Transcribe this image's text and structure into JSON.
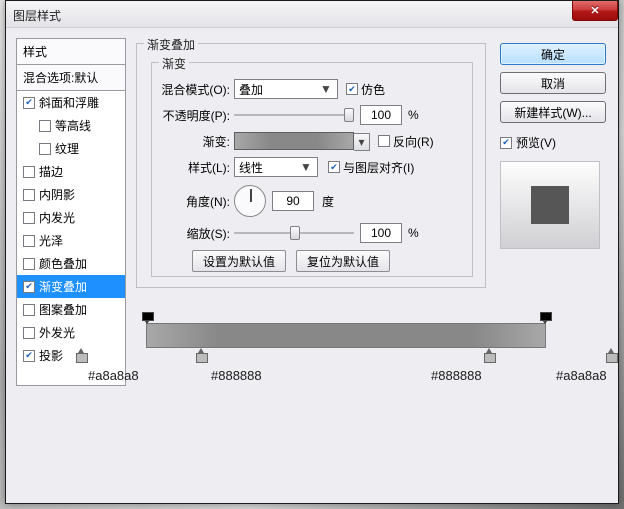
{
  "window": {
    "title": "图层样式"
  },
  "styles_panel": {
    "header": "样式",
    "blend_defaults": "混合选项:默认",
    "items": [
      {
        "label": "斜面和浮雕",
        "checked": true,
        "indent": false
      },
      {
        "label": "等高线",
        "checked": false,
        "indent": true
      },
      {
        "label": "纹理",
        "checked": false,
        "indent": true
      },
      {
        "label": "描边",
        "checked": false,
        "indent": false
      },
      {
        "label": "内阴影",
        "checked": false,
        "indent": false
      },
      {
        "label": "内发光",
        "checked": false,
        "indent": false
      },
      {
        "label": "光泽",
        "checked": false,
        "indent": false
      },
      {
        "label": "颜色叠加",
        "checked": false,
        "indent": false
      },
      {
        "label": "渐变叠加",
        "checked": true,
        "indent": false,
        "selected": true
      },
      {
        "label": "图案叠加",
        "checked": false,
        "indent": false
      },
      {
        "label": "外发光",
        "checked": false,
        "indent": false
      },
      {
        "label": "投影",
        "checked": true,
        "indent": false
      }
    ]
  },
  "group": {
    "outer_title": "渐变叠加",
    "inner_title": "渐变",
    "blendmode_label": "混合模式(O):",
    "blendmode_value": "叠加",
    "dither_label": "仿色",
    "dither_checked": true,
    "opacity_label": "不透明度(P):",
    "opacity_value": "100",
    "opacity_unit": "%",
    "gradient_label": "渐变:",
    "reverse_label": "反向(R)",
    "reverse_checked": false,
    "style_label": "样式(L):",
    "style_value": "线性",
    "align_label": "与图层对齐(I)",
    "align_checked": true,
    "angle_label": "角度(N):",
    "angle_value": "90",
    "angle_unit": "度",
    "scale_label": "缩放(S):",
    "scale_value": "100",
    "scale_unit": "%",
    "btn_default": "设置为默认值",
    "btn_reset": "复位为默认值"
  },
  "right": {
    "ok": "确定",
    "cancel": "取消",
    "newstyle": "新建样式(W)...",
    "preview_label": "预览(V)",
    "preview_checked": true
  },
  "gradient_stops": {
    "c1": "#a8a8a8",
    "c2": "#888888",
    "c3": "#888888",
    "c4": "#a8a8a8"
  }
}
